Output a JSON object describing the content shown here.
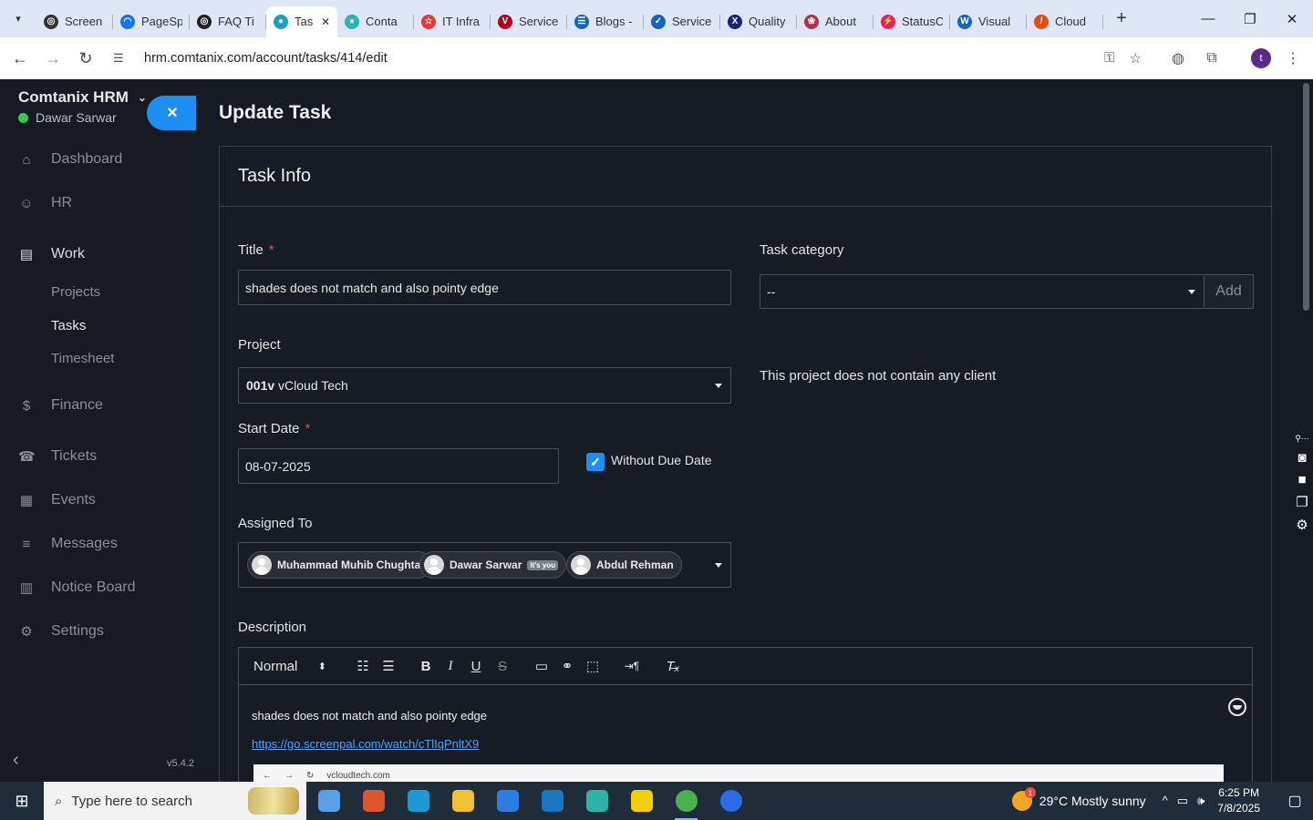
{
  "browser": {
    "tabs": [
      {
        "label": "Screen",
        "color": "#333333",
        "glyph": "◎"
      },
      {
        "label": "PageSp",
        "color": "#1a73e8",
        "glyph": "◠"
      },
      {
        "label": "FAQ Ti",
        "color": "#222222",
        "glyph": "◎"
      },
      {
        "label": "Tas",
        "color": "#1aa1c4",
        "glyph": "●",
        "active": true
      },
      {
        "label": "Conta",
        "color": "#2bb3c0",
        "glyph": "●"
      },
      {
        "label": "IT Infra",
        "color": "#e53935",
        "glyph": "☆"
      },
      {
        "label": "Service",
        "color": "#b00020",
        "glyph": "V"
      },
      {
        "label": "Blogs -",
        "color": "#1565c0",
        "glyph": "☰"
      },
      {
        "label": "Service",
        "color": "#1565c0",
        "glyph": "✓"
      },
      {
        "label": "Quality",
        "color": "#1a237e",
        "glyph": "X"
      },
      {
        "label": "About",
        "color": "#b0334a",
        "glyph": "❀"
      },
      {
        "label": "StatusC",
        "color": "#e91e63",
        "glyph": "⚡"
      },
      {
        "label": "Visual",
        "color": "#1565c0",
        "glyph": "W"
      },
      {
        "label": "Cloud",
        "color": "#e64a19",
        "glyph": "/"
      }
    ],
    "url": "hrm.comtanix.com/account/tasks/414/edit",
    "profile_initial": "t"
  },
  "sidebar": {
    "brand": "Comtanix HRM",
    "user": "Dawar Sarwar",
    "menu": [
      {
        "label": "Dashboard",
        "icon": "⌂"
      },
      {
        "label": "HR",
        "icon": "☺"
      },
      {
        "label": "Work",
        "icon": "▤"
      },
      {
        "label": "Finance",
        "icon": "$"
      },
      {
        "label": "Tickets",
        "icon": "☎"
      },
      {
        "label": "Events",
        "icon": "▦"
      },
      {
        "label": "Messages",
        "icon": "≡"
      },
      {
        "label": "Notice Board",
        "icon": "▥"
      },
      {
        "label": "Settings",
        "icon": "⚙"
      }
    ],
    "work_sub": [
      "Projects",
      "Tasks",
      "Timesheet"
    ],
    "version": "v5.4.2"
  },
  "page": {
    "title": "Update Task",
    "card_title": "Task Info",
    "title_label": "Title",
    "title_value": "shades does not match and also pointy edge",
    "category_label": "Task category",
    "category_value": "--",
    "add_label": "Add",
    "project_label": "Project",
    "project_code": "001v",
    "project_name": "vCloud Tech",
    "no_client_note": "This project does not contain any client",
    "start_label": "Start Date",
    "start_value": "08-07-2025",
    "due_checkbox_label": "Without Due Date",
    "assigned_label": "Assigned To",
    "assignees": [
      {
        "name": "Muhammad Muhib Chughtai"
      },
      {
        "name": "Dawar Sarwar",
        "badge": "It's you"
      },
      {
        "name": "Abdul Rehman"
      }
    ],
    "description_label": "Description",
    "editor_format": "Normal",
    "description_text": "shades does not match and also pointy edge",
    "description_link": "https://go.screenpal.com/watch/cTlIqPnltX9",
    "embedded_url": "vcloudtech.com"
  },
  "taskbar": {
    "search_placeholder": "Type here to search",
    "weather": "29°C  Mostly sunny",
    "time": "6:25 PM",
    "date": "7/8/2025",
    "apps": [
      "#5aa0e8",
      "#e0562b",
      "#1a9bd7",
      "#f0c030",
      "#2b7de0",
      "#1a78c2",
      "#2bb3a8",
      "#f5d000",
      "#4caf50",
      "#2d6be4"
    ]
  }
}
